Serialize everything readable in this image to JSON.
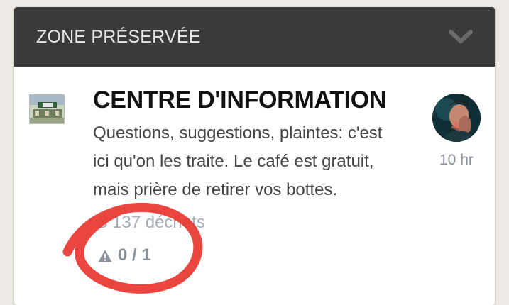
{
  "category": {
    "header_title": "ZONE PRÉSERVÉE",
    "toggle_icon": "chevron-down-icon"
  },
  "topic": {
    "thumbnail_icon": "topic-thumbnail-image",
    "title": "CENTRE D'INFORMATION",
    "description_lines": [
      "Questions, suggestions, plaintes: c'est",
      "ici qu'on les traite. Le café est gratuit,",
      "mais prière de retirer vos bottes."
    ],
    "posts_count": "3 137 déchets",
    "flag_icon": "warning-icon",
    "flag_count": "0 / 1",
    "last_poster_avatar": "avatar",
    "last_activity": "10 hr"
  },
  "colors": {
    "header_bg": "#3a3a3a",
    "accent_circle": "#e8362f"
  }
}
